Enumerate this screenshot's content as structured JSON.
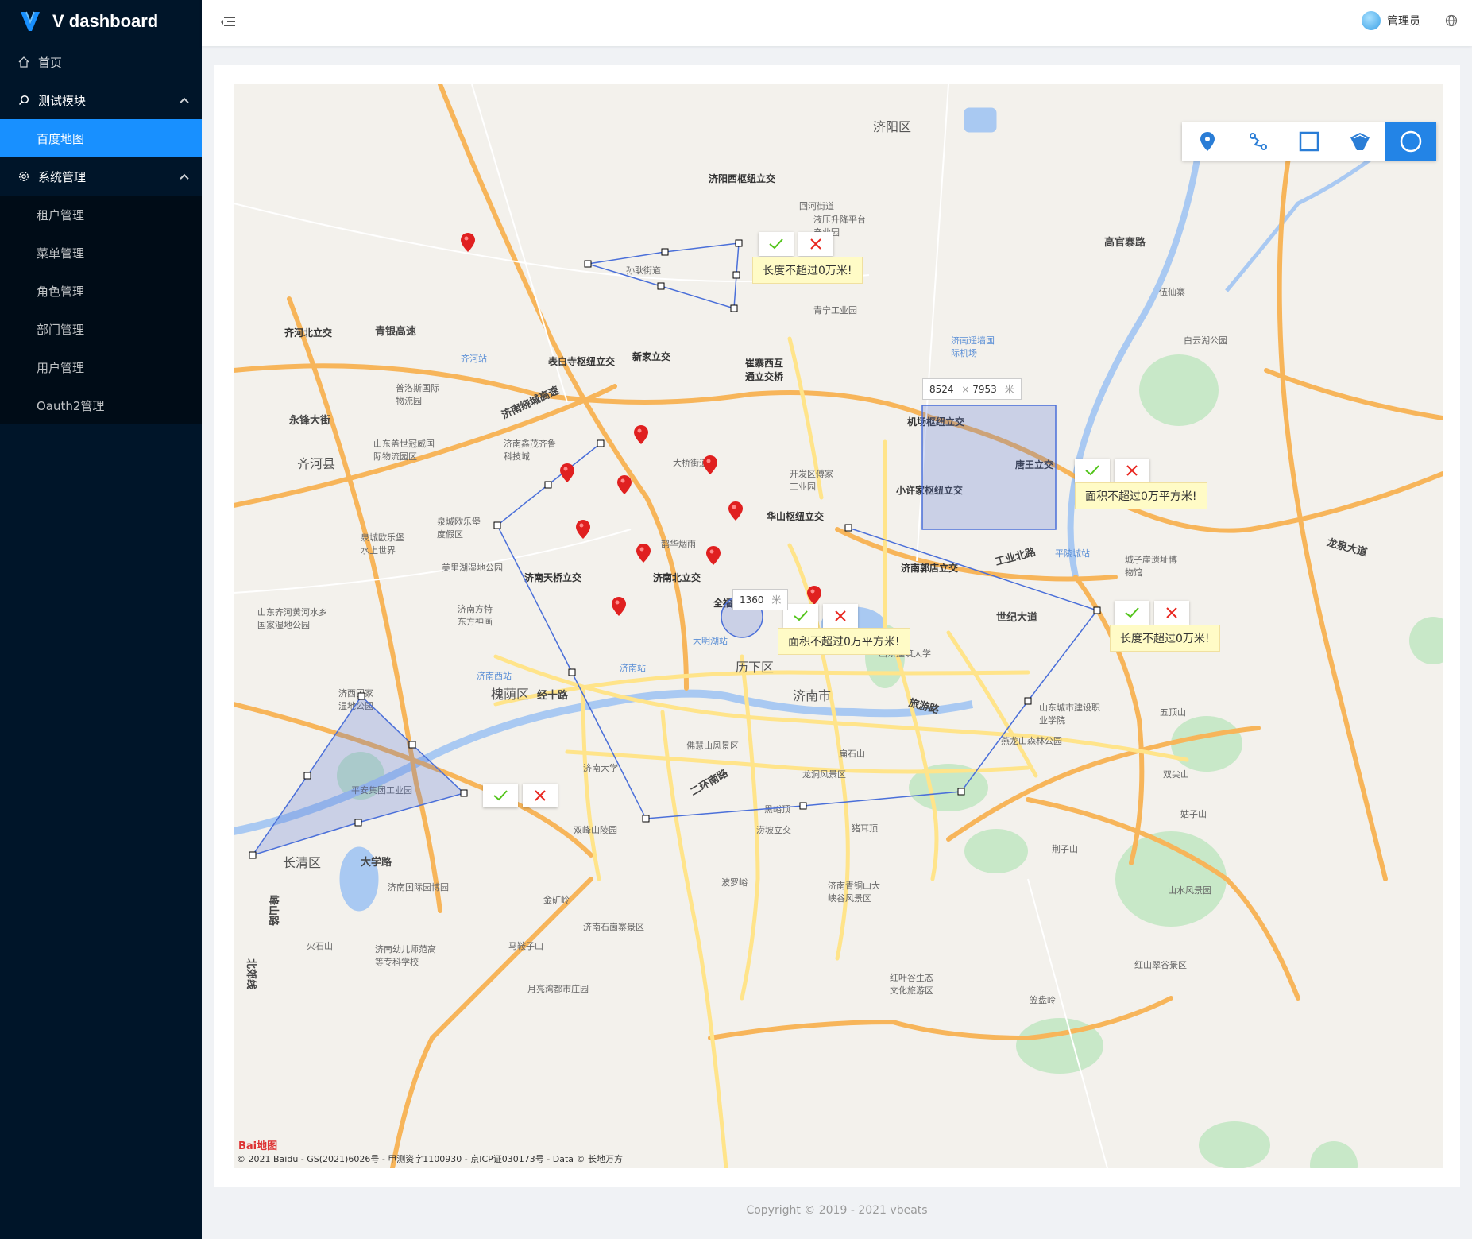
{
  "app": {
    "title": "V dashboard"
  },
  "sidebar": {
    "home": "首页",
    "test_module": {
      "label": "测试模块",
      "items": [
        "百度地图"
      ]
    },
    "system": {
      "label": "系统管理",
      "items": [
        "租户管理",
        "菜单管理",
        "角色管理",
        "部门管理",
        "用户管理",
        "Oauth2管理"
      ]
    }
  },
  "header": {
    "user": "管理员"
  },
  "map": {
    "labels": [
      "济阳区",
      "济阳西枢纽立交",
      "回河街道",
      "液压升降平台产业园",
      "青宁工业园",
      "济南遥墙国际机场",
      "白云湖公园",
      "高官寨路",
      "伍仙寨",
      "孙耿街道",
      "齐河北立交",
      "青银高速",
      "齐河站",
      "表白寺枢纽立交",
      "新家立交",
      "崔寨西互通立交桥",
      "普洛斯国际物流园",
      "济南绕城高速",
      "永锋大街",
      "山东盖世冠威国际物流园区",
      "济南鑫茂齐鲁科技城",
      "齐河县",
      "大桥街道",
      "开发区傅家工业园",
      "机场枢纽立交",
      "唐王立交",
      "小许家枢纽立交",
      "华山枢纽立交",
      "泉城欧乐堡度假区",
      "泉城欧乐堡水上世界",
      "鹊华烟雨",
      "美里湖湿地公园",
      "济南天桥立交",
      "济南北立交",
      "济南郭店立交",
      "工业北路",
      "平陵城站",
      "城子崖遗址博物馆",
      "龙泉大道",
      "山东齐河黄河水乡国家湿地公园",
      "济南方特东方神画",
      "世纪大道",
      "全福立交",
      "大明湖站",
      "济南站",
      "济南西站",
      "历下区",
      "济南市",
      "槐荫区",
      "经十路",
      "山东建筑大学",
      "旅游路",
      "山东城市建设职业学院",
      "五顶山",
      "济西国家湿地公园",
      "佛慧山风景区",
      "燕龙山森林公园",
      "扁石山",
      "龙洞风景区",
      "济南大学",
      "二环南路",
      "平安集团工业园",
      "双峰山陵园",
      "黑峪顶",
      "涝坡立交",
      "猪耳顶",
      "荆子山",
      "长清区",
      "大学路",
      "济南国际园博园",
      "金矿岭",
      "济南石崮寨景区",
      "波罗峪",
      "济南青铜山大峡谷风景区",
      "山水风景园",
      "马鞍子山",
      "火石山",
      "济南幼儿师范高等专科学校",
      "红叶谷生态文化旅游区",
      "红山翠谷景区",
      "月亮湾都市庄园",
      "笠盘岭",
      "双尖山",
      "姑子山",
      "峰山路",
      "北郊线"
    ]
  },
  "toolbar": {
    "tools": [
      {
        "name": "marker",
        "icon": "marker-icon"
      },
      {
        "name": "polyline",
        "icon": "polyline-icon"
      },
      {
        "name": "rectangle",
        "icon": "rectangle-icon"
      },
      {
        "name": "polygon",
        "icon": "polygon-icon"
      },
      {
        "name": "circle",
        "icon": "circle-icon",
        "active": true
      }
    ]
  },
  "tips": {
    "length1": "长度不超过0万米!",
    "area_rect": "面积不超过0万平方米!",
    "area_circle": "面积不超过0万平方米!",
    "length2": "长度不超过0万米!"
  },
  "measures": {
    "rect_w": "8524",
    "rect_h": "7953",
    "rect_sep": "×",
    "rect_unit": "米",
    "circle_r": "1360",
    "circle_unit": "米"
  },
  "attribution": "© 2021 Baidu - GS(2021)6026号 - 甲测资字1100930 - 京ICP证030173号 - Data © 长地万方",
  "baidu_logo": "Bai地图",
  "footer": "Copyright © 2019 - 2021 vbeats",
  "colors": {
    "primary": "#1890ff",
    "sidebar": "#001529",
    "submenu": "#000c17",
    "confirm": "#52c41a",
    "cancel": "#e8261f"
  }
}
